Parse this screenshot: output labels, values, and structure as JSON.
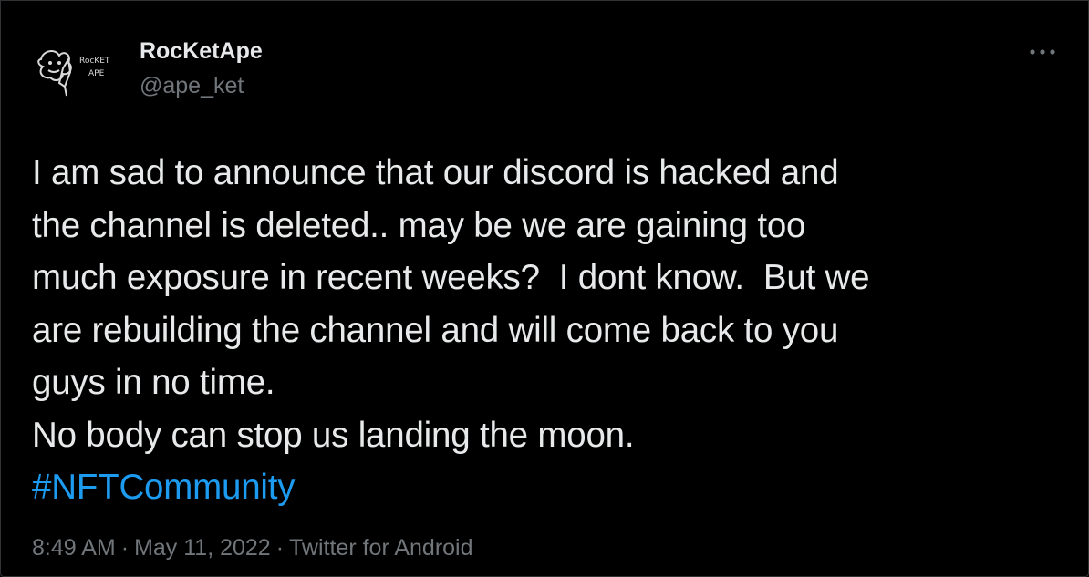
{
  "author": {
    "display_name": "RocKetApe",
    "handle": "@ape_ket",
    "avatar_text_line1": "RocKET",
    "avatar_text_line2": "APE"
  },
  "more_icon": "more-horizontal-icon",
  "tweet": {
    "lines": [
      "I am sad to announce that our discord is hacked and",
      "the channel is deleted.. may be we are gaining too",
      "much exposure in recent weeks?  I dont know.  But we",
      "are rebuilding the channel and will come back to you",
      "guys in no time.",
      "No body can stop us landing the moon."
    ],
    "hashtag": "#NFTCommunity"
  },
  "meta": {
    "time": "8:49 AM",
    "separator": "·",
    "date": "May 11, 2022",
    "source": "Twitter for Android"
  },
  "colors": {
    "background": "#000000",
    "text": "#e7e9ea",
    "secondary": "#71767b",
    "link": "#1d9bf0"
  }
}
